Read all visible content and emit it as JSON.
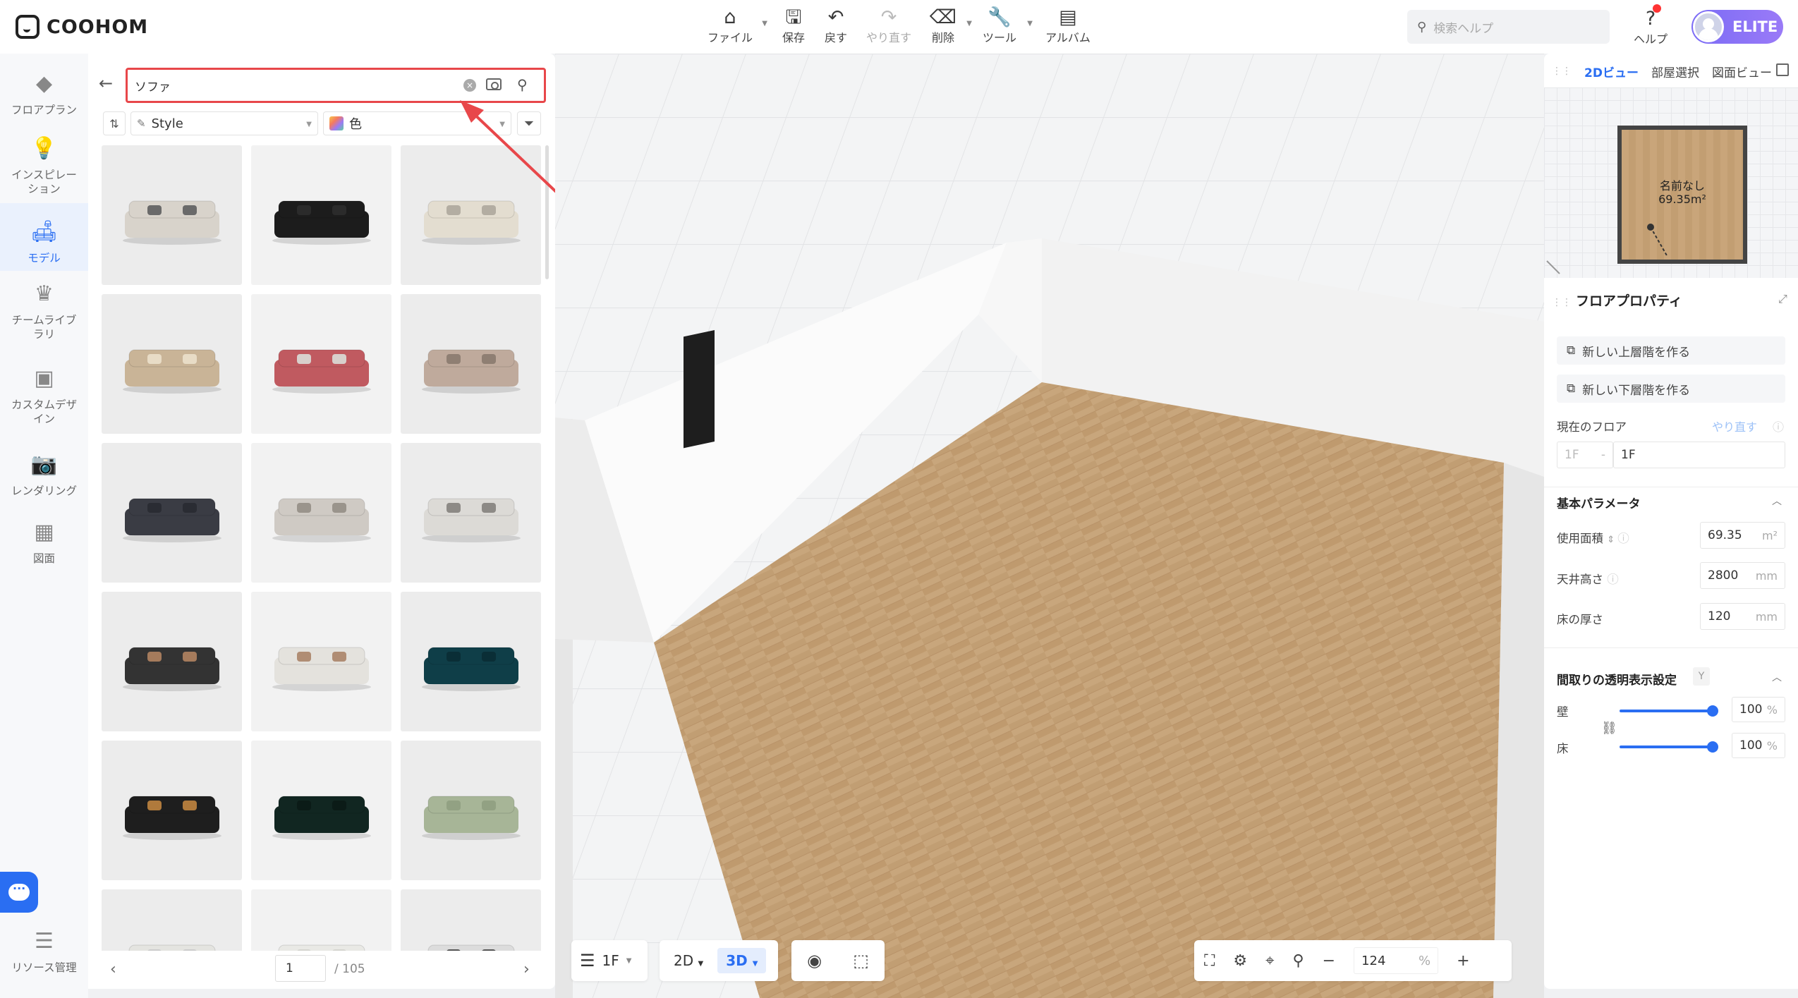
{
  "app": {
    "logo_text": "COOHOM"
  },
  "toolbar": {
    "file": "ファイル",
    "save": "保存",
    "undo": "戻す",
    "redo": "やり直す",
    "delete": "削除",
    "tools": "ツール",
    "album": "アルバム",
    "search_placeholder": "検索ヘルプ",
    "help": "ヘルプ",
    "badge": "ELITE"
  },
  "rail": {
    "items": [
      {
        "label": "フロアプラン",
        "icon": "floorplan-icon"
      },
      {
        "label": "インスピレーション",
        "icon": "lightbulb-icon"
      },
      {
        "label": "モデル",
        "icon": "sofa-icon",
        "active": true
      },
      {
        "label": "チームライブラリ",
        "icon": "crown-icon"
      },
      {
        "label": "カスタムデザイン",
        "icon": "box-icon"
      },
      {
        "label": "レンダリング",
        "icon": "camera-icon"
      },
      {
        "label": "図面",
        "icon": "drawing-icon"
      }
    ],
    "bottom": "リソース管理"
  },
  "panel": {
    "search_value": "ソファ",
    "style_label": "Style",
    "color_label": "色",
    "products": [
      {
        "color": "#d8d3cb",
        "accent": "#6a6a6a"
      },
      {
        "color": "#1c1c1c",
        "accent": "#2b2b2b"
      },
      {
        "color": "#e3ddd0",
        "accent": "#b3ada2"
      },
      {
        "color": "#c9b497",
        "accent": "#e8dcc6"
      },
      {
        "color": "#c05a60",
        "accent": "#d8d0cc"
      },
      {
        "color": "#bfaa9c",
        "accent": "#8f7f73"
      },
      {
        "color": "#3a3c44",
        "accent": "#2a2c33"
      },
      {
        "color": "#cfcac4",
        "accent": "#9a948c"
      },
      {
        "color": "#dcdad6",
        "accent": "#8d8a86"
      },
      {
        "color": "#333333",
        "accent": "#a57b5c"
      },
      {
        "color": "#e4e2dd",
        "accent": "#b08d74"
      },
      {
        "color": "#0f3e48",
        "accent": "#0a2e36"
      },
      {
        "color": "#1e1e1e",
        "accent": "#b07a3c"
      },
      {
        "color": "#112621",
        "accent": "#0b1b17"
      },
      {
        "color": "#a7b597",
        "accent": "#92a183"
      },
      {
        "color": "#e4e4e0",
        "accent": "#cccccc"
      },
      {
        "color": "#e9e9e5",
        "accent": "#d5d5d0"
      },
      {
        "color": "#dcdcdc",
        "accent": "#555555"
      }
    ],
    "page_current": "1",
    "page_total": "/ 105"
  },
  "viewport": {
    "floor": "1F",
    "mode_2d": "2D",
    "mode_3d": "3D",
    "zoom": "124",
    "zoom_unit": "%"
  },
  "right": {
    "tabs": [
      "2Dビュー",
      "部屋選択",
      "図面ビュー"
    ],
    "minimap_room_name": "名前なし",
    "minimap_room_area": "69.35m²",
    "section_title": "フロアプロパティ",
    "new_upper": "新しい上層階を作る",
    "new_lower": "新しい下層階を作る",
    "current_floor_label": "現在のフロア",
    "redo_link": "やり直す",
    "floor_code": "1F",
    "floor_name": "1F",
    "basic_params": "基本パラメータ",
    "area_label": "使用面積",
    "area_value": "69.35",
    "area_unit": "m²",
    "ceiling_label": "天井高さ",
    "ceiling_value": "2800",
    "ceiling_unit": "mm",
    "floor_thick_label": "床の厚さ",
    "floor_thick_value": "120",
    "floor_thick_unit": "mm",
    "transparency_title": "間取りの透明表示設定",
    "transparency_tag": "Y",
    "wall_label": "壁",
    "wall_value": "100",
    "floor_label": "床",
    "floor_value": "100",
    "pct": "%",
    "wall_level": 1.0,
    "floor_level": 1.0
  }
}
